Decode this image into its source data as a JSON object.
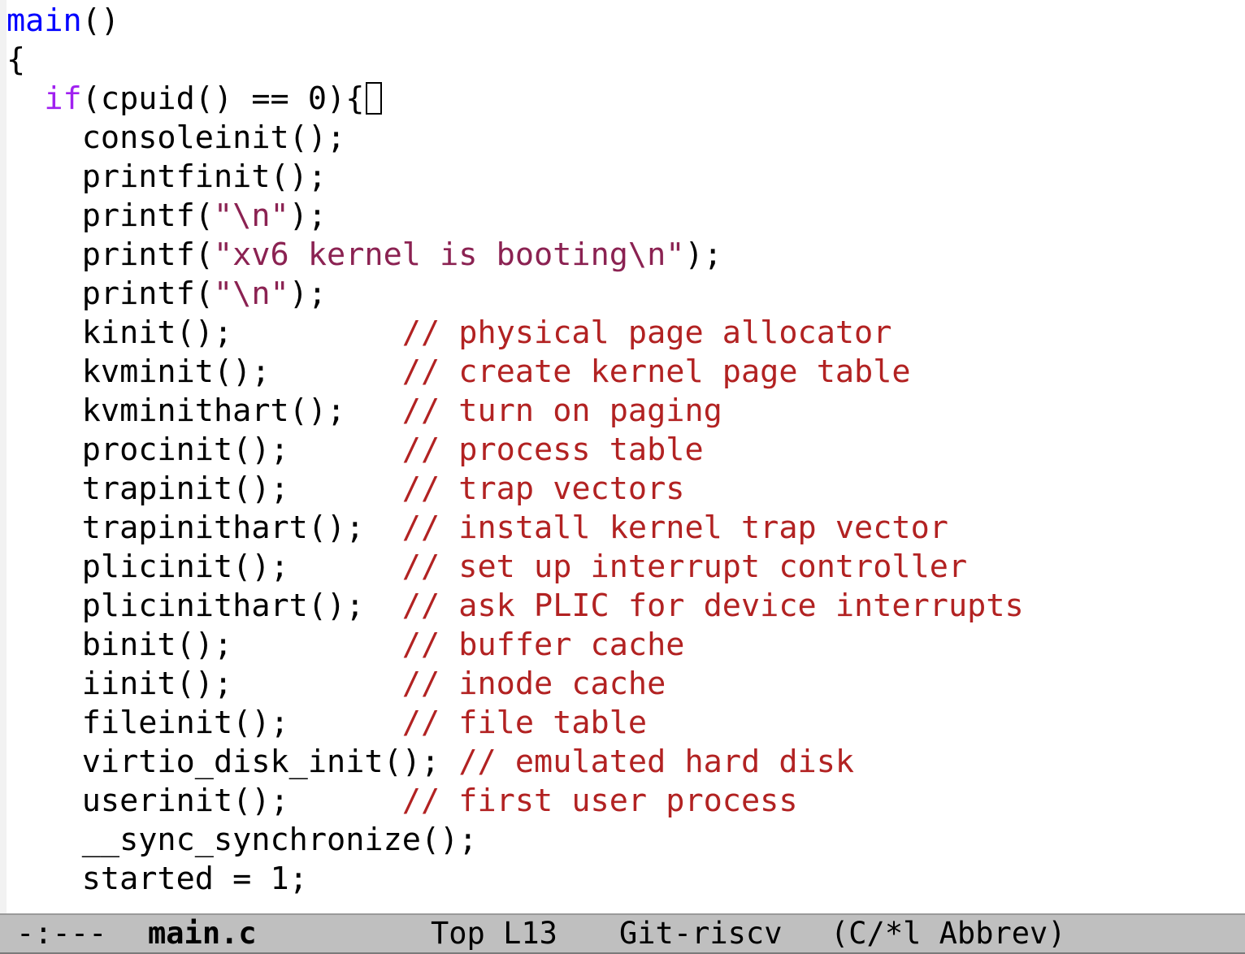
{
  "editor": {
    "lines": [
      {
        "indent": "",
        "tokens": [
          {
            "t": "main",
            "c": "fn"
          },
          {
            "t": "()",
            "c": "plain"
          }
        ]
      },
      {
        "indent": "",
        "tokens": [
          {
            "t": "{",
            "c": "plain"
          }
        ]
      },
      {
        "indent": "  ",
        "tokens": [
          {
            "t": "if",
            "c": "kw"
          },
          {
            "t": "(cpuid() == 0){",
            "c": "plain"
          }
        ],
        "cursor": true
      },
      {
        "indent": "    ",
        "tokens": [
          {
            "t": "consoleinit();",
            "c": "plain"
          }
        ]
      },
      {
        "indent": "    ",
        "tokens": [
          {
            "t": "printfinit();",
            "c": "plain"
          }
        ]
      },
      {
        "indent": "    ",
        "tokens": [
          {
            "t": "printf(",
            "c": "plain"
          },
          {
            "t": "\"\\n\"",
            "c": "str"
          },
          {
            "t": ");",
            "c": "plain"
          }
        ]
      },
      {
        "indent": "    ",
        "tokens": [
          {
            "t": "printf(",
            "c": "plain"
          },
          {
            "t": "\"xv6 kernel is booting\\n\"",
            "c": "str"
          },
          {
            "t": ");",
            "c": "plain"
          }
        ]
      },
      {
        "indent": "    ",
        "tokens": [
          {
            "t": "printf(",
            "c": "plain"
          },
          {
            "t": "\"\\n\"",
            "c": "str"
          },
          {
            "t": ");",
            "c": "plain"
          }
        ]
      },
      {
        "indent": "    ",
        "tokens": [
          {
            "t": "kinit();         ",
            "c": "plain"
          },
          {
            "t": "// physical page allocator",
            "c": "comment"
          }
        ]
      },
      {
        "indent": "    ",
        "tokens": [
          {
            "t": "kvminit();       ",
            "c": "plain"
          },
          {
            "t": "// create kernel page table",
            "c": "comment"
          }
        ]
      },
      {
        "indent": "    ",
        "tokens": [
          {
            "t": "kvminithart();   ",
            "c": "plain"
          },
          {
            "t": "// turn on paging",
            "c": "comment"
          }
        ]
      },
      {
        "indent": "    ",
        "tokens": [
          {
            "t": "procinit();      ",
            "c": "plain"
          },
          {
            "t": "// process table",
            "c": "comment"
          }
        ]
      },
      {
        "indent": "    ",
        "tokens": [
          {
            "t": "trapinit();      ",
            "c": "plain"
          },
          {
            "t": "// trap vectors",
            "c": "comment"
          }
        ]
      },
      {
        "indent": "    ",
        "tokens": [
          {
            "t": "trapinithart();  ",
            "c": "plain"
          },
          {
            "t": "// install kernel trap vector",
            "c": "comment"
          }
        ]
      },
      {
        "indent": "    ",
        "tokens": [
          {
            "t": "plicinit();      ",
            "c": "plain"
          },
          {
            "t": "// set up interrupt controller",
            "c": "comment"
          }
        ]
      },
      {
        "indent": "    ",
        "tokens": [
          {
            "t": "plicinithart();  ",
            "c": "plain"
          },
          {
            "t": "// ask PLIC for device interrupts",
            "c": "comment"
          }
        ]
      },
      {
        "indent": "    ",
        "tokens": [
          {
            "t": "binit();         ",
            "c": "plain"
          },
          {
            "t": "// buffer cache",
            "c": "comment"
          }
        ]
      },
      {
        "indent": "    ",
        "tokens": [
          {
            "t": "iinit();         ",
            "c": "plain"
          },
          {
            "t": "// inode cache",
            "c": "comment"
          }
        ]
      },
      {
        "indent": "    ",
        "tokens": [
          {
            "t": "fileinit();      ",
            "c": "plain"
          },
          {
            "t": "// file table",
            "c": "comment"
          }
        ]
      },
      {
        "indent": "    ",
        "tokens": [
          {
            "t": "virtio_disk_init(); ",
            "c": "plain"
          },
          {
            "t": "// emulated hard disk",
            "c": "comment"
          }
        ]
      },
      {
        "indent": "    ",
        "tokens": [
          {
            "t": "userinit();      ",
            "c": "plain"
          },
          {
            "t": "// first user process",
            "c": "comment"
          }
        ]
      },
      {
        "indent": "    ",
        "tokens": [
          {
            "t": "__sync_synchronize();",
            "c": "plain"
          }
        ]
      },
      {
        "indent": "    ",
        "tokens": [
          {
            "t": "started = 1;",
            "c": "plain"
          }
        ]
      }
    ]
  },
  "mode_line": {
    "status": "-:---",
    "buffer_name": "main.c",
    "position": "Top L13",
    "vc": "Git-riscv",
    "modes": "(C/*l Abbrev)"
  },
  "colors": {
    "function_name": "#0000ff",
    "keyword": "#a020f0",
    "string": "#8b2252",
    "comment": "#b22222",
    "mode_line_bg": "#bfbfbf"
  }
}
